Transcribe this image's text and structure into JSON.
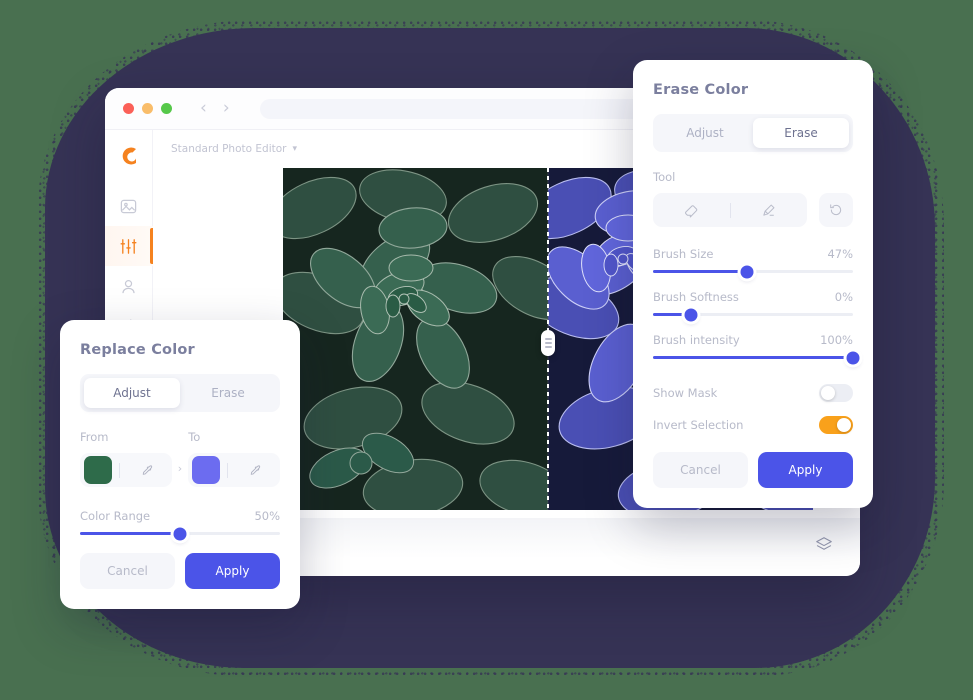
{
  "theme": {
    "page_background": "#497050",
    "blob_color": "#363355",
    "accent_blue": "#4b54e8",
    "accent_orange": "#f5821f",
    "toggle_on": "#f9a11b",
    "title_text": "#7b7f9e",
    "muted_text": "#b7bac9"
  },
  "app_window": {
    "traffic_lights": [
      "red",
      "yellow",
      "green"
    ],
    "nav": {
      "back_icon": "chevron-left-icon",
      "forward_icon": "chevron-right-icon"
    },
    "address_placeholder": "",
    "logo_icon": "app-logo-icon",
    "sidebar": [
      {
        "icon": "image-icon",
        "name": "sidebar-item-image",
        "active": false
      },
      {
        "icon": "adjust-sliders-icon",
        "name": "sidebar-item-adjust",
        "active": true
      },
      {
        "icon": "person-icon",
        "name": "sidebar-item-portrait",
        "active": false
      },
      {
        "icon": "sparkles-icon",
        "name": "sidebar-item-effects",
        "active": false
      }
    ],
    "preset_label": "Standard Photo Editor",
    "preset_caret": "chevron-down-icon",
    "bottom_bar": {
      "undo_icon": "undo-icon",
      "redo_icon": "redo-icon",
      "layers_icon": "layers-icon"
    },
    "canvas": {
      "compare_divider": "split-compare-divider",
      "left_label": "original-green-succulents",
      "right_label": "recolored-blue-succulents"
    }
  },
  "erase_panel": {
    "title": "Erase Color",
    "tabs": [
      {
        "label": "Adjust",
        "active": false
      },
      {
        "label": "Erase",
        "active": true
      }
    ],
    "tool_label": "Tool",
    "tools": [
      {
        "icon": "eraser-icon",
        "name": "eraser-tool"
      },
      {
        "icon": "brush-icon",
        "name": "brush-tool"
      }
    ],
    "reset_icon": "reset-icon",
    "sliders": [
      {
        "label": "Brush Size",
        "value": "47%",
        "percent": 47
      },
      {
        "label": "Brush Softness",
        "value": "0%",
        "percent": 19
      },
      {
        "label": "Brush intensity",
        "value": "100%",
        "percent": 100
      }
    ],
    "toggles": [
      {
        "label": "Show Mask",
        "on": false
      },
      {
        "label": "Invert Selection",
        "on": true
      }
    ],
    "cancel_label": "Cancel",
    "apply_label": "Apply"
  },
  "replace_panel": {
    "title": "Replace Color",
    "tabs": [
      {
        "label": "Adjust",
        "active": true
      },
      {
        "label": "Erase",
        "active": false
      }
    ],
    "from_label": "From",
    "to_label": "To",
    "from_color": "#2e6b4a",
    "to_color": "#6c6cf0",
    "dropper_icon": "eyedropper-icon",
    "arrow": "›",
    "slider": {
      "label": "Color Range",
      "value": "50%",
      "percent": 50
    },
    "cancel_label": "Cancel",
    "apply_label": "Apply"
  }
}
